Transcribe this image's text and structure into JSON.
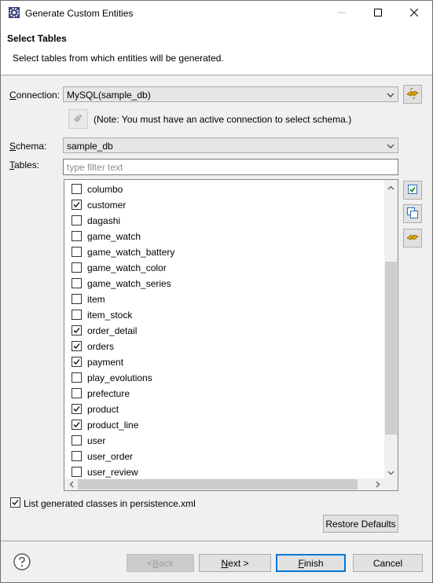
{
  "window": {
    "title": "Generate Custom Entities",
    "icons": {
      "app": "eclipse-gear-icon",
      "minimize": "minimize-icon",
      "maximize": "maximize-icon",
      "close": "close-icon"
    }
  },
  "header": {
    "title": "Select Tables",
    "description": "Select tables from which entities will be generated."
  },
  "connection": {
    "label_key": "C",
    "label_rest": "onnection:",
    "value": "MySQL(sample_db)",
    "button_icon": "connect-icon",
    "schema_button_icon": "reconnect-icon",
    "note": "(Note: You must have an active connection to select schema.)"
  },
  "schema": {
    "label_key": "S",
    "label_rest": "chema:",
    "value": "sample_db"
  },
  "tables": {
    "label_key": "T",
    "label_rest": "ables:",
    "filter_placeholder": "type filter text",
    "items": [
      {
        "name": "columbo",
        "checked": false
      },
      {
        "name": "customer",
        "checked": true
      },
      {
        "name": "dagashi",
        "checked": false
      },
      {
        "name": "game_watch",
        "checked": false
      },
      {
        "name": "game_watch_battery",
        "checked": false
      },
      {
        "name": "game_watch_color",
        "checked": false
      },
      {
        "name": "game_watch_series",
        "checked": false
      },
      {
        "name": "item",
        "checked": false
      },
      {
        "name": "item_stock",
        "checked": false
      },
      {
        "name": "order_detail",
        "checked": true
      },
      {
        "name": "orders",
        "checked": true
      },
      {
        "name": "payment",
        "checked": true
      },
      {
        "name": "play_evolutions",
        "checked": false
      },
      {
        "name": "prefecture",
        "checked": false
      },
      {
        "name": "product",
        "checked": true
      },
      {
        "name": "product_line",
        "checked": true
      },
      {
        "name": "user",
        "checked": false
      },
      {
        "name": "user_order",
        "checked": false
      },
      {
        "name": "user_review",
        "checked": false
      }
    ],
    "side_buttons": {
      "select_all": "select-all-icon",
      "deselect_all": "deselect-all-icon",
      "refresh": "refresh-icon"
    }
  },
  "persistence": {
    "checked": true,
    "label": "List generated classes in persistence.xml"
  },
  "restore_defaults": "Restore Defaults",
  "footer": {
    "help_icon": "help-icon",
    "back": {
      "prefix": "< ",
      "key": "B",
      "rest": "ack"
    },
    "next": {
      "key": "N",
      "rest": "ext >"
    },
    "finish": {
      "key": "F",
      "rest": "inish"
    },
    "cancel": "Cancel"
  },
  "colors": {
    "accent": "#0078d7",
    "window_border": "#6f6f6f",
    "dialog_bg": "#f0f0f0"
  }
}
